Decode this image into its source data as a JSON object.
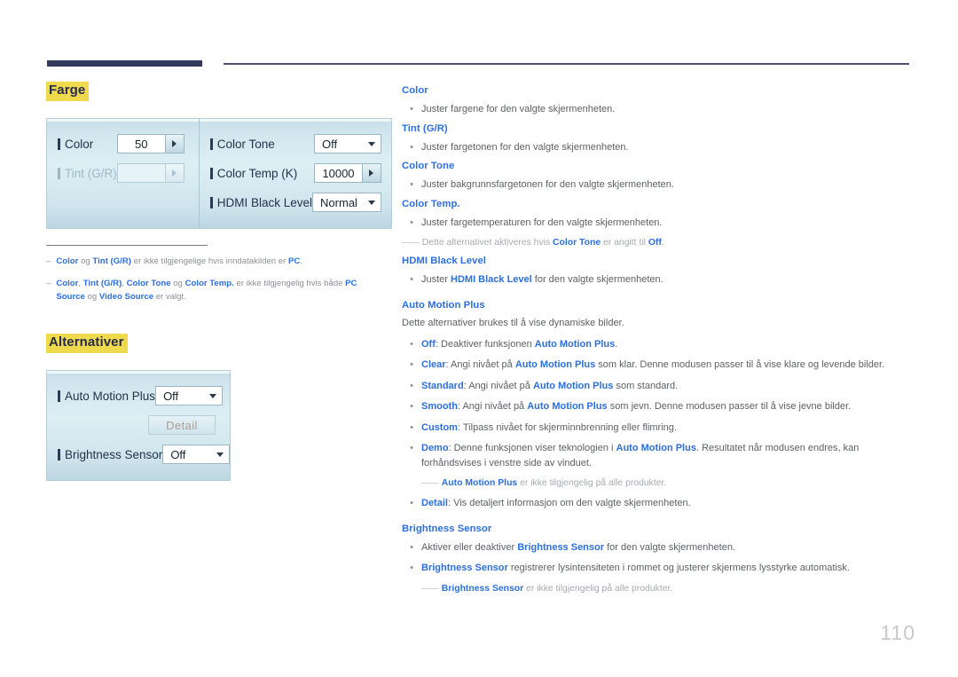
{
  "page": {
    "number": "110"
  },
  "header": {
    "rule_color": "#343a5e"
  },
  "left": {
    "section1": {
      "heading": "Farge",
      "panel": {
        "column1": [
          {
            "label": "Color",
            "value": "50",
            "control": "spinner",
            "enabled": true
          },
          {
            "label": "Tint (G/R)",
            "value": "",
            "control": "spinner",
            "enabled": false
          }
        ],
        "column2": [
          {
            "label": "Color Tone",
            "value": "Off",
            "control": "dropdown",
            "enabled": true
          },
          {
            "label": "Color Temp (K)",
            "value": "10000",
            "control": "spinner",
            "enabled": true
          },
          {
            "label": "HDMI Black Level",
            "value": "Normal",
            "control": "dropdown",
            "enabled": true
          }
        ]
      },
      "notes": [
        {
          "parts": [
            {
              "t": "Color",
              "b": true
            },
            {
              "t": " og "
            },
            {
              "t": "Tint (G/R)",
              "b": true
            },
            {
              "t": " er ikke tilgjengelige hvis inndatakilden er "
            },
            {
              "t": "PC",
              "b": true
            },
            {
              "t": "."
            }
          ]
        },
        {
          "parts": [
            {
              "t": "Color",
              "b": true
            },
            {
              "t": ", "
            },
            {
              "t": "Tint (G/R)",
              "b": true
            },
            {
              "t": ", "
            },
            {
              "t": "Color Tone",
              "b": true
            },
            {
              "t": " og "
            },
            {
              "t": "Color Temp.",
              "b": true
            },
            {
              "t": " er ikke tilgjengelig hvis både "
            },
            {
              "t": "PC Source",
              "b": true
            },
            {
              "t": " og "
            },
            {
              "t": "Video Source",
              "b": true
            },
            {
              "t": " er valgt."
            }
          ]
        }
      ]
    },
    "section2": {
      "heading": "Alternativer",
      "panel": {
        "rows": [
          {
            "label": "Auto Motion Plus",
            "value": "Off",
            "control": "dropdown",
            "enabled": true
          },
          {
            "label": "",
            "value": "Detail",
            "control": "button",
            "enabled": false
          },
          {
            "label": "Brightness Sensor",
            "value": "Off",
            "control": "dropdown",
            "enabled": true
          }
        ]
      }
    }
  },
  "right": {
    "blocks": [
      {
        "type": "head",
        "text": "Color"
      },
      {
        "type": "bullet",
        "parts": [
          {
            "t": "Juster fargene for den valgte skjermenheten."
          }
        ]
      },
      {
        "type": "head",
        "text": "Tint (G/R)"
      },
      {
        "type": "bullet",
        "parts": [
          {
            "t": "Juster fargetonen for den valgte skjermenheten."
          }
        ]
      },
      {
        "type": "head",
        "text": "Color Tone"
      },
      {
        "type": "bullet",
        "parts": [
          {
            "t": "Juster bakgrunnsfargetonen for den valgte skjermenheten."
          }
        ]
      },
      {
        "type": "head",
        "text": "Color Temp."
      },
      {
        "type": "bullet",
        "parts": [
          {
            "t": "Juster fargetemperaturen for den valgte skjermenheten."
          }
        ]
      },
      {
        "type": "sub",
        "parts": [
          {
            "t": "Dette alternativet aktiveres hvis "
          },
          {
            "t": "Color Tone",
            "b": true
          },
          {
            "t": " er angitt til "
          },
          {
            "t": "Off",
            "b": true
          },
          {
            "t": "."
          }
        ]
      },
      {
        "type": "head",
        "text": "HDMI Black Level"
      },
      {
        "type": "bullet",
        "parts": [
          {
            "t": "Juster "
          },
          {
            "t": "HDMI Black Level",
            "b": true
          },
          {
            "t": " for den valgte skjermenheten."
          }
        ]
      },
      {
        "type": "head",
        "text": "Auto Motion Plus",
        "spaced": true
      },
      {
        "type": "plain",
        "parts": [
          {
            "t": "Dette alternativer brukes til å vise dynamiske bilder."
          }
        ]
      },
      {
        "type": "bullet",
        "parts": [
          {
            "t": "Off",
            "b": true
          },
          {
            "t": ": Deaktiver funksjonen "
          },
          {
            "t": "Auto Motion Plus",
            "b": true
          },
          {
            "t": "."
          }
        ]
      },
      {
        "type": "bullet",
        "parts": [
          {
            "t": "Clear",
            "b": true
          },
          {
            "t": ": Angi nivået på "
          },
          {
            "t": "Auto Motion Plus",
            "b": true
          },
          {
            "t": " som klar. Denne modusen passer til å vise klare og levende bilder."
          }
        ]
      },
      {
        "type": "bullet",
        "parts": [
          {
            "t": "Standard",
            "b": true
          },
          {
            "t": ": Angi nivået på "
          },
          {
            "t": "Auto Motion Plus",
            "b": true
          },
          {
            "t": " som standard."
          }
        ]
      },
      {
        "type": "bullet",
        "parts": [
          {
            "t": "Smooth",
            "b": true
          },
          {
            "t": ": Angi nivået på "
          },
          {
            "t": "Auto Motion Plus",
            "b": true
          },
          {
            "t": " som jevn. Denne modusen passer til å vise jevne bilder."
          }
        ]
      },
      {
        "type": "bullet",
        "parts": [
          {
            "t": "Custom",
            "b": true
          },
          {
            "t": ": Tilpass nivået for skjerminnbrenning eller flimring."
          }
        ]
      },
      {
        "type": "bullet",
        "parts": [
          {
            "t": "Demo",
            "b": true
          },
          {
            "t": ": Denne funksjonen viser teknologien i "
          },
          {
            "t": "Auto Motion Plus",
            "b": true
          },
          {
            "t": ". Resultatet når modusen endres, kan forhåndsvises i venstre side av vinduet."
          }
        ]
      },
      {
        "type": "sub",
        "indent": true,
        "parts": [
          {
            "t": "Auto Motion Plus",
            "b": true
          },
          {
            "t": " er ikke tilgjengelig på alle produkter."
          }
        ]
      },
      {
        "type": "bullet",
        "parts": [
          {
            "t": "Detail",
            "b": true
          },
          {
            "t": ": Vis detaljert informasjon om den valgte skjermenheten."
          }
        ]
      },
      {
        "type": "head",
        "text": "Brightness Sensor",
        "spaced": true
      },
      {
        "type": "bullet",
        "parts": [
          {
            "t": "Aktiver eller deaktiver "
          },
          {
            "t": "Brightness Sensor",
            "b": true
          },
          {
            "t": " for den valgte skjermenheten."
          }
        ]
      },
      {
        "type": "bullet",
        "parts": [
          {
            "t": "Brightness Sensor",
            "b": true
          },
          {
            "t": " registrerer lysintensiteten i rommet og justerer skjermens lysstyrke automatisk."
          }
        ]
      },
      {
        "type": "sub",
        "indent": true,
        "parts": [
          {
            "t": "Brightness Sensor",
            "b": true
          },
          {
            "t": " er ikke tilgjengelig på alle produkter."
          }
        ]
      }
    ]
  }
}
